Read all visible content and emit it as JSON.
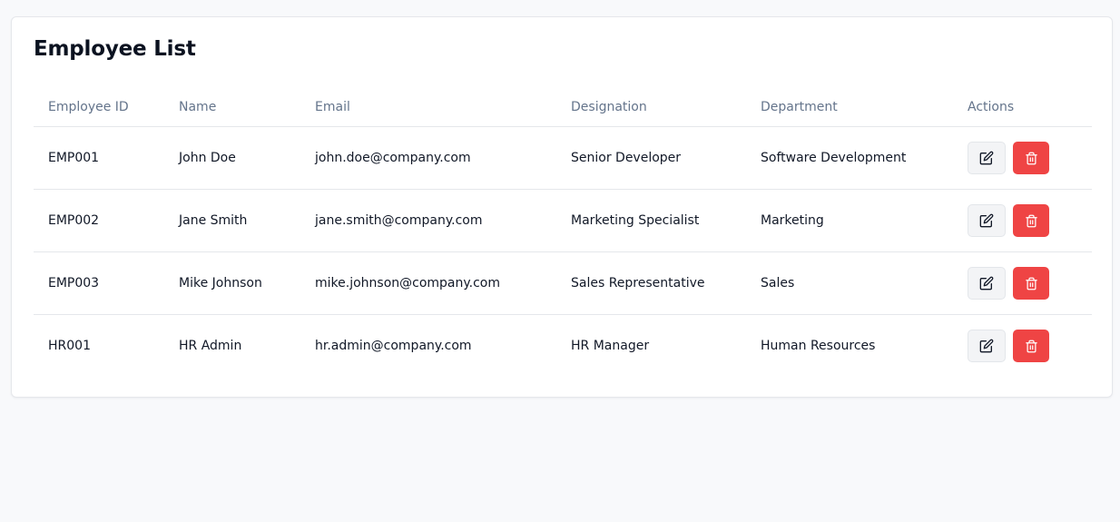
{
  "page": {
    "title": "Employee List"
  },
  "table": {
    "columns": [
      "Employee ID",
      "Name",
      "Email",
      "Designation",
      "Department",
      "Actions"
    ],
    "rows": [
      {
        "id": "EMP001",
        "name": "John Doe",
        "email": "john.doe@company.com",
        "designation": "Senior Developer",
        "department": "Software Development"
      },
      {
        "id": "EMP002",
        "name": "Jane Smith",
        "email": "jane.smith@company.com",
        "designation": "Marketing Specialist",
        "department": "Marketing"
      },
      {
        "id": "EMP003",
        "name": "Mike Johnson",
        "email": "mike.johnson@company.com",
        "designation": "Sales Representative",
        "department": "Sales"
      },
      {
        "id": "HR001",
        "name": "HR Admin",
        "email": "hr.admin@company.com",
        "designation": "HR Manager",
        "department": "Human Resources"
      }
    ]
  },
  "icons": {
    "edit": "edit-icon",
    "delete": "trash-icon"
  },
  "colors": {
    "danger": "#ef4444",
    "header_text": "#64748b",
    "border": "#e5e7eb"
  }
}
